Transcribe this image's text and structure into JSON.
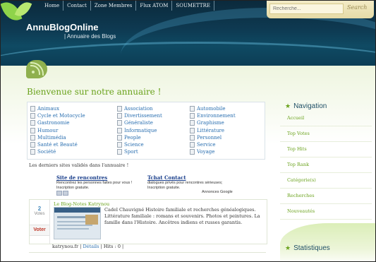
{
  "nav": {
    "items": [
      "Home",
      "Contact",
      "Zone Membres",
      "Flux ATOM",
      "SOUMETTRE"
    ]
  },
  "search": {
    "placeholder": "Recherche...",
    "button": "Search"
  },
  "site": {
    "title": "AnnuBlogOnline",
    "subtitle": "| Annuaire des Blogs"
  },
  "welcome": "Bienvenue sur notre annuaire !",
  "categories": {
    "col1": [
      "Animaux",
      "Cycle et Motocycle",
      "Gastronomie",
      "Humour",
      "Multimédia",
      "Santé et Beauté",
      "Société"
    ],
    "col2": [
      "Association",
      "Divertissement",
      "Généraliste",
      "Informatique",
      "People",
      "Science",
      "Sport"
    ],
    "col3": [
      "Automobile",
      "Environnement",
      "Graphisme",
      "Littérature",
      "Personnel",
      "Service",
      "Voyage"
    ]
  },
  "last_sites": "Les derniers sites validés dans l'annuaire !",
  "ads": {
    "ad1_title": "Site de rencontres",
    "ad1_text": "Rencontrez les personnes faites pour vous ! Inscription gratuite.",
    "ad2_title": "Tchat Contact",
    "ad2_text": "dialogues privés pour rencontres sérieuses; Inscription gratuite.",
    "google": "Annonces Google"
  },
  "listing": {
    "votes": "2",
    "votes_label": "Votes",
    "vote_button": "Voter",
    "title": "Le Blog-Notes Katrynou",
    "description": "Cadel Chauvigné Histoire familiale et recherches généalogiques. Littérature familiale : romans et souvenirs. Photos et peintures. La famille dans l'Histoire. Ancêtres indiens et russes garantis.",
    "domain": "katrynou.fr",
    "details": "Détails",
    "hits": "| Hits : 0 |"
  },
  "sidebar": {
    "nav_title": "Navigation",
    "items": [
      "Accueil",
      "Top Votes",
      "Top Hits",
      "Top Rank",
      "Catégorie(s)",
      "Recherches",
      "Nouveautés"
    ],
    "stats_title": "Statistiques"
  },
  "colors": {
    "header_dark": "#0b2a3c",
    "green_accent": "#6aa21c",
    "link_blue": "#2a6fb0"
  }
}
